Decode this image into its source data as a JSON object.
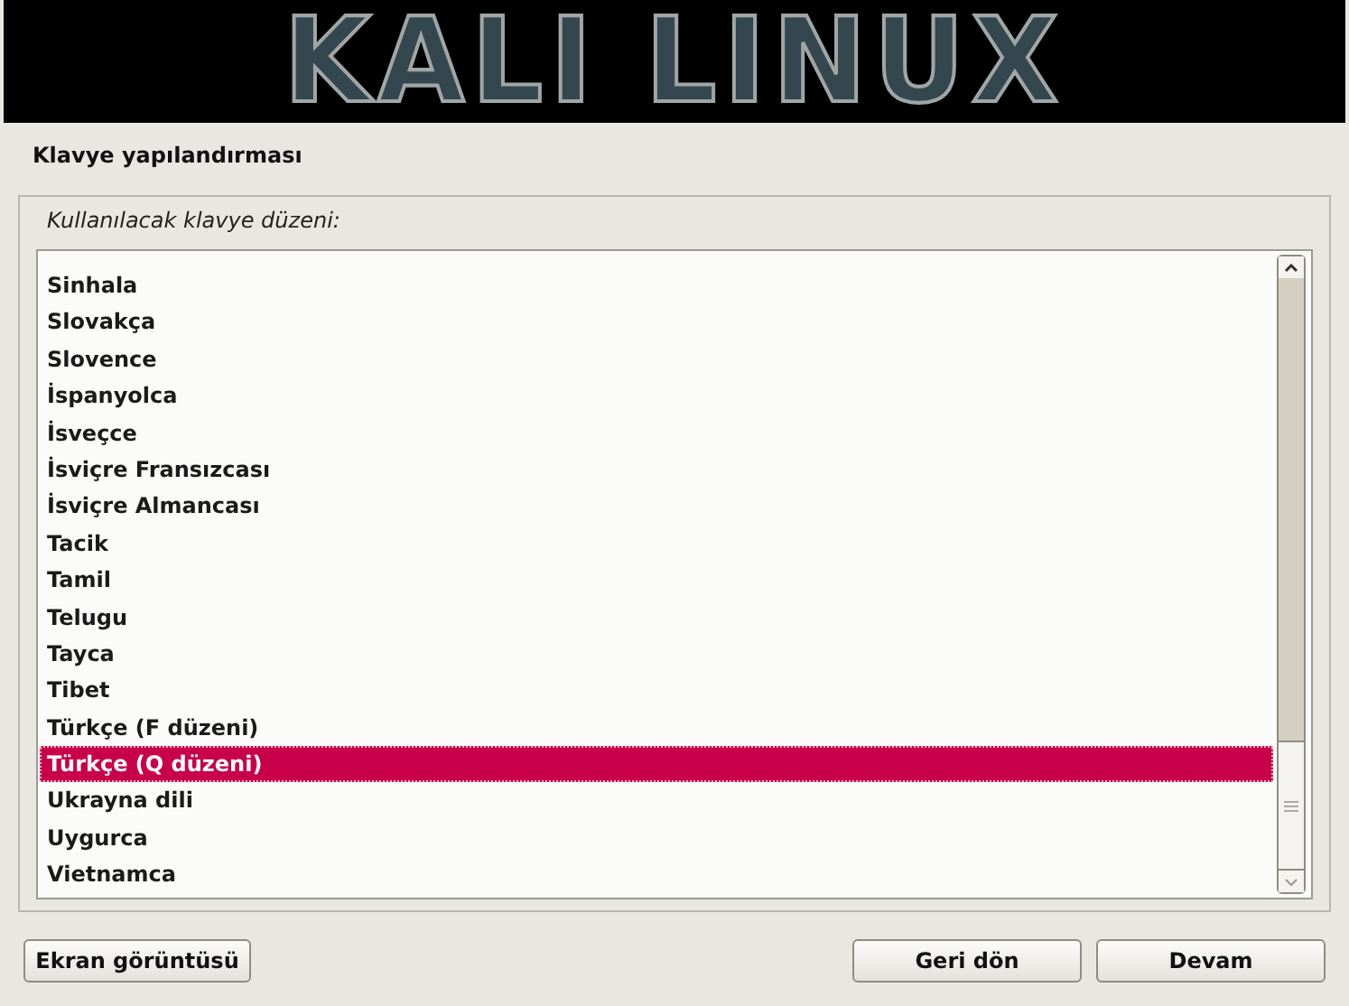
{
  "banner": {
    "logo": "KALI LINUX"
  },
  "section_title": "Klavye yapılandırması",
  "layout_list": {
    "label": "Kullanılacak klavye düzeni:",
    "items": [
      {
        "label": "Sinhala",
        "selected": false
      },
      {
        "label": "Slovakça",
        "selected": false
      },
      {
        "label": "Slovence",
        "selected": false
      },
      {
        "label": "İspanyolca",
        "selected": false
      },
      {
        "label": "İsveçce",
        "selected": false
      },
      {
        "label": "İsviçre Fransızcası",
        "selected": false
      },
      {
        "label": "İsviçre Almancası",
        "selected": false
      },
      {
        "label": "Tacik",
        "selected": false
      },
      {
        "label": "Tamil",
        "selected": false
      },
      {
        "label": "Telugu",
        "selected": false
      },
      {
        "label": "Tayca",
        "selected": false
      },
      {
        "label": "Tibet",
        "selected": false
      },
      {
        "label": "Türkçe (F düzeni)",
        "selected": false
      },
      {
        "label": "Türkçe (Q düzeni)",
        "selected": true
      },
      {
        "label": "Ukrayna dili",
        "selected": false
      },
      {
        "label": "Uygurca",
        "selected": false
      },
      {
        "label": "Vietnamca",
        "selected": false
      }
    ]
  },
  "buttons": {
    "left": [
      "Ekran görüntüsü"
    ],
    "right": [
      "Geri dön",
      "Devam"
    ]
  }
}
